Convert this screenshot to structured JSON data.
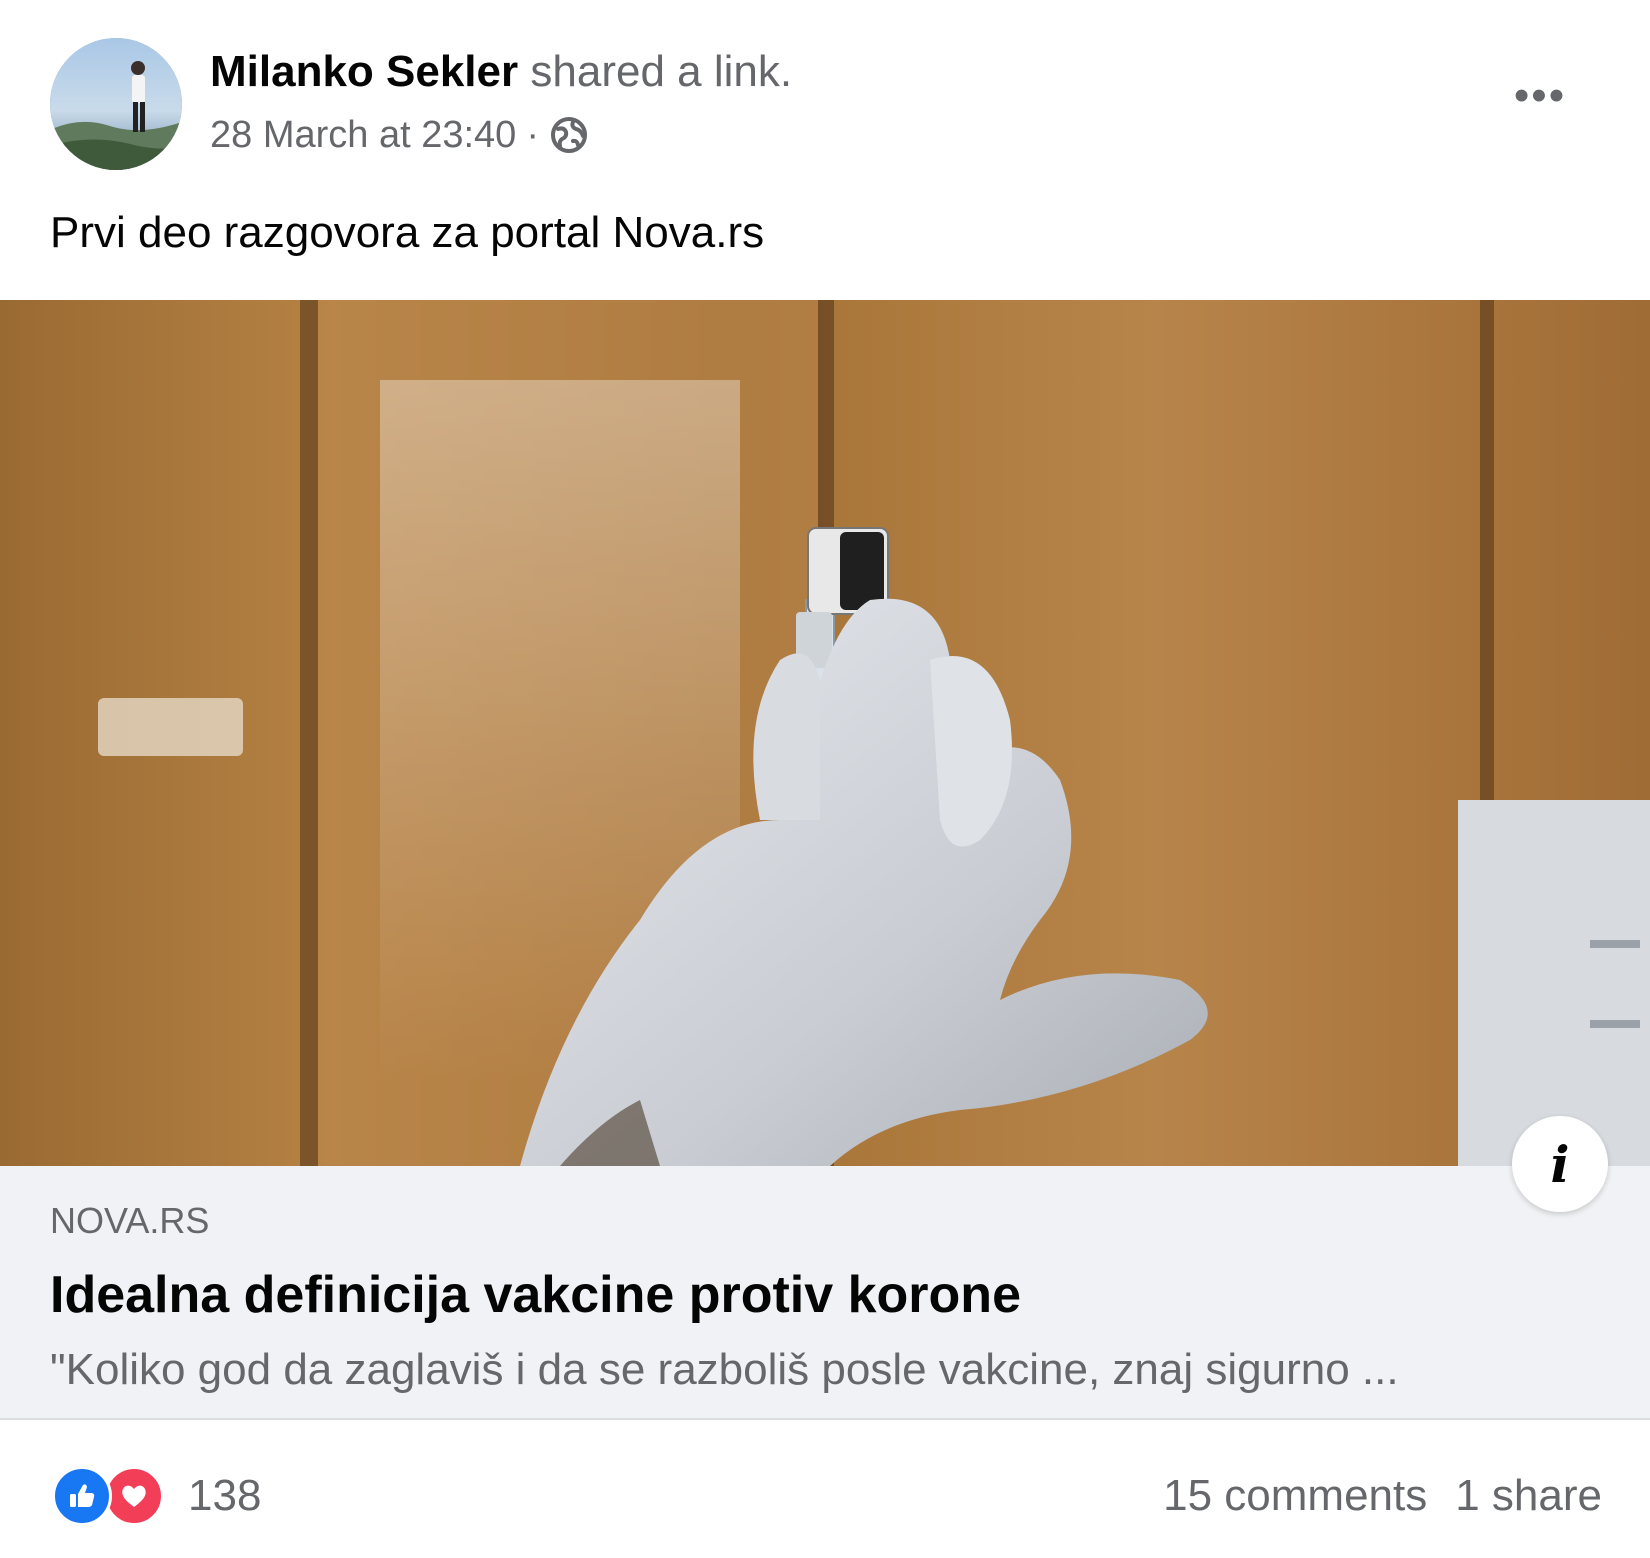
{
  "post": {
    "author": "Milanko Sekler",
    "action": "shared a link.",
    "timestamp": "28 March at 23:40",
    "separator": "·",
    "privacy_icon": "globe-icon",
    "more_icon": "more-options-icon",
    "more_label": "•••",
    "text": "Prvi deo razgovora za portal Nova.rs"
  },
  "link": {
    "image_description_icon": "vaccine-syringe-photo",
    "info_label": "i",
    "domain": "NOVA.RS",
    "title": "Idealna definicija vakcine protiv korone",
    "description": "\"Koliko god da zaglaviš i da se razboliš posle vakcine, znaj sigurno ..."
  },
  "footer": {
    "reaction_icons": [
      "like-icon",
      "love-icon"
    ],
    "reaction_count": "138",
    "comments": "15 comments",
    "shares": "1 share"
  },
  "colors": {
    "like": "#1877f2",
    "love": "#f33e58",
    "secondary_text": "#65676b",
    "caption_bg": "#f0f2f5"
  }
}
